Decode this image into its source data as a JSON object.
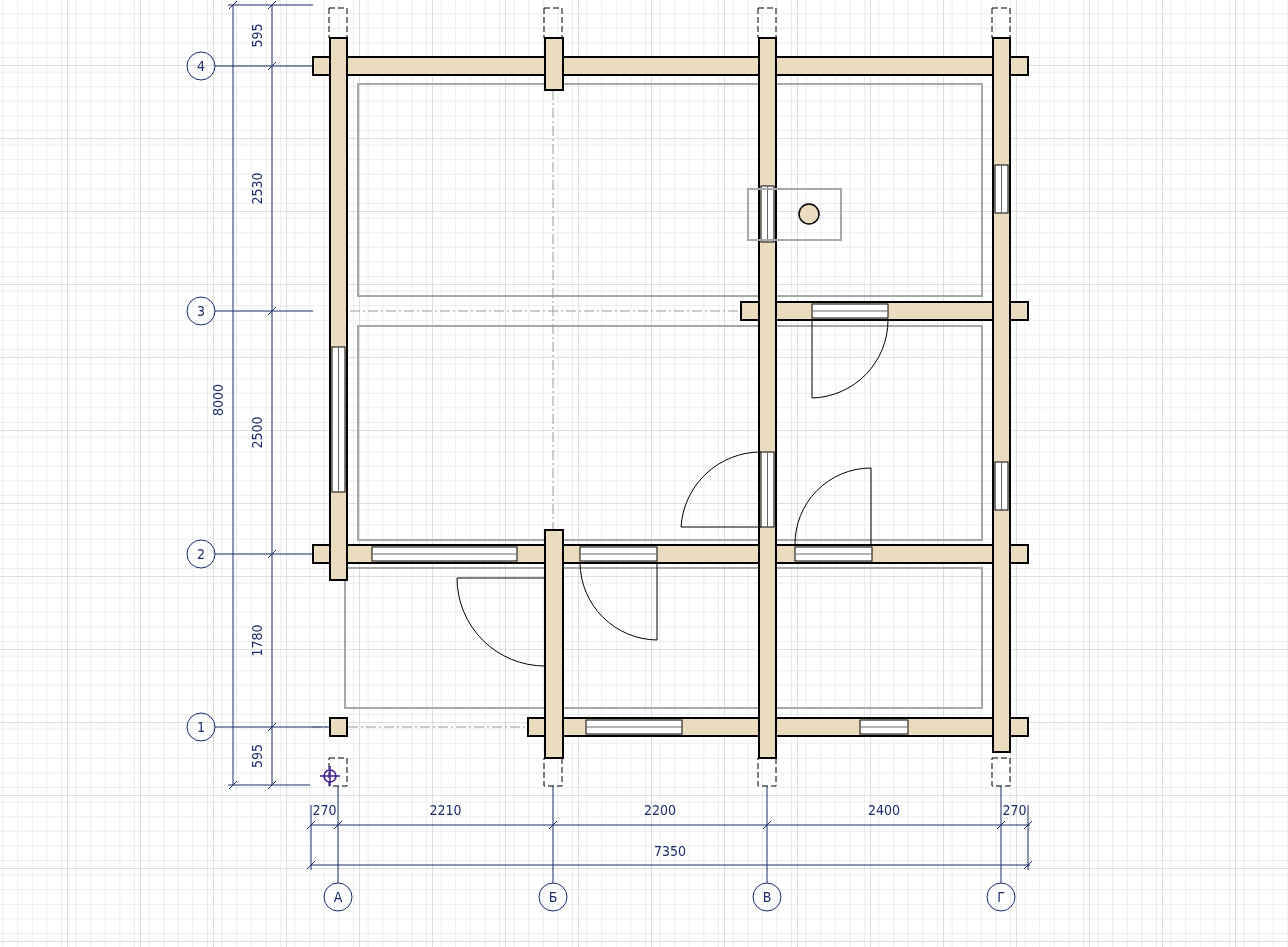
{
  "plan": {
    "axes_letters": [
      "А",
      "Б",
      "В",
      "Г"
    ],
    "axes_numbers": [
      "4",
      "3",
      "2",
      "1"
    ],
    "dimensions_vertical": [
      "595",
      "2530",
      "2500",
      "1780",
      "595"
    ],
    "overall_vertical": "8000",
    "dimensions_horizontal": [
      "270",
      "2210",
      "2200",
      "2400",
      "270"
    ],
    "overall_horizontal": "7350"
  }
}
